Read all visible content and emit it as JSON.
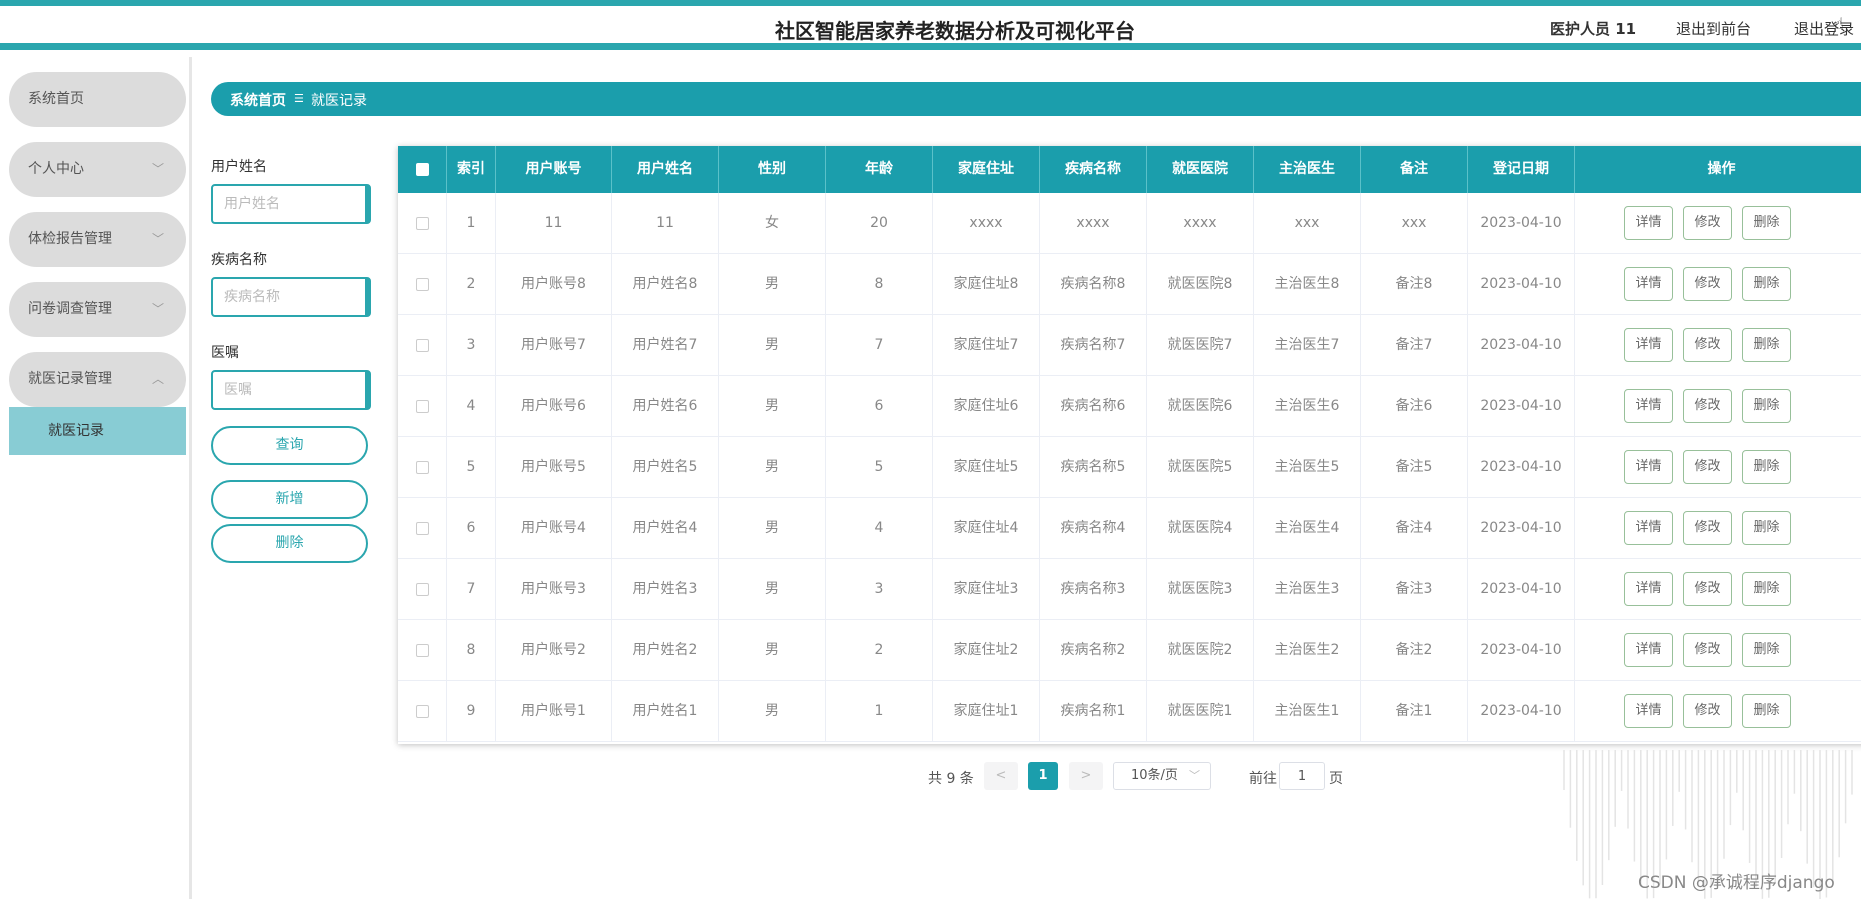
{
  "header": {
    "title": "社区智能居家养老数据分析及可视化平台",
    "user": "医护人员 11",
    "front_link": "退出到前台",
    "logout_link": "退出登录"
  },
  "sidebar": {
    "items": [
      {
        "label": "系统首页"
      },
      {
        "label": "个人中心"
      },
      {
        "label": "体检报告管理"
      },
      {
        "label": "问卷调查管理"
      },
      {
        "label": "就医记录管理"
      }
    ],
    "active_sub": "就医记录"
  },
  "breadcrumb": {
    "home": "系统首页",
    "separator": "☰",
    "current": "就医记录"
  },
  "search": {
    "name_label": "用户姓名",
    "name_placeholder": "用户姓名",
    "disease_label": "疾病名称",
    "disease_placeholder": "疾病名称",
    "advice_label": "医嘱",
    "advice_placeholder": "医嘱",
    "query_button": "查询",
    "add_button": "新增",
    "delete_button": "删除"
  },
  "table": {
    "columns": [
      "索引",
      "用户账号",
      "用户姓名",
      "性别",
      "年龄",
      "家庭住址",
      "疾病名称",
      "就医医院",
      "主治医生",
      "备注",
      "登记日期",
      "操作"
    ],
    "actions": {
      "detail": "详情",
      "edit": "修改",
      "delete": "删除"
    },
    "rows": [
      [
        "1",
        "11",
        "11",
        "女",
        "20",
        "xxxx",
        "xxxx",
        "xxxx",
        "xxx",
        "xxx",
        "2023-04-10"
      ],
      [
        "2",
        "用户账号8",
        "用户姓名8",
        "男",
        "8",
        "家庭住址8",
        "疾病名称8",
        "就医医院8",
        "主治医生8",
        "备注8",
        "2023-04-10"
      ],
      [
        "3",
        "用户账号7",
        "用户姓名7",
        "男",
        "7",
        "家庭住址7",
        "疾病名称7",
        "就医医院7",
        "主治医生7",
        "备注7",
        "2023-04-10"
      ],
      [
        "4",
        "用户账号6",
        "用户姓名6",
        "男",
        "6",
        "家庭住址6",
        "疾病名称6",
        "就医医院6",
        "主治医生6",
        "备注6",
        "2023-04-10"
      ],
      [
        "5",
        "用户账号5",
        "用户姓名5",
        "男",
        "5",
        "家庭住址5",
        "疾病名称5",
        "就医医院5",
        "主治医生5",
        "备注5",
        "2023-04-10"
      ],
      [
        "6",
        "用户账号4",
        "用户姓名4",
        "男",
        "4",
        "家庭住址4",
        "疾病名称4",
        "就医医院4",
        "主治医生4",
        "备注4",
        "2023-04-10"
      ],
      [
        "7",
        "用户账号3",
        "用户姓名3",
        "男",
        "3",
        "家庭住址3",
        "疾病名称3",
        "就医医院3",
        "主治医生3",
        "备注3",
        "2023-04-10"
      ],
      [
        "8",
        "用户账号2",
        "用户姓名2",
        "男",
        "2",
        "家庭住址2",
        "疾病名称2",
        "就医医院2",
        "主治医生2",
        "备注2",
        "2023-04-10"
      ],
      [
        "9",
        "用户账号1",
        "用户姓名1",
        "男",
        "1",
        "家庭住址1",
        "疾病名称1",
        "就医医院1",
        "主治医生1",
        "备注1",
        "2023-04-10"
      ]
    ]
  },
  "pagination": {
    "total": "共 9 条",
    "prev": "<",
    "current_page": "1",
    "next": ">",
    "page_size": "10条/页",
    "goto_prefix": "前往",
    "goto_value": "1",
    "goto_suffix": "页"
  },
  "watermark": "CSDN @承诚程序django",
  "colors": {
    "accent": "#1b9eac",
    "sidebar_bg": "#dcdcdc",
    "sub_active": "#88ccd4",
    "op_border": "#98c09a"
  }
}
